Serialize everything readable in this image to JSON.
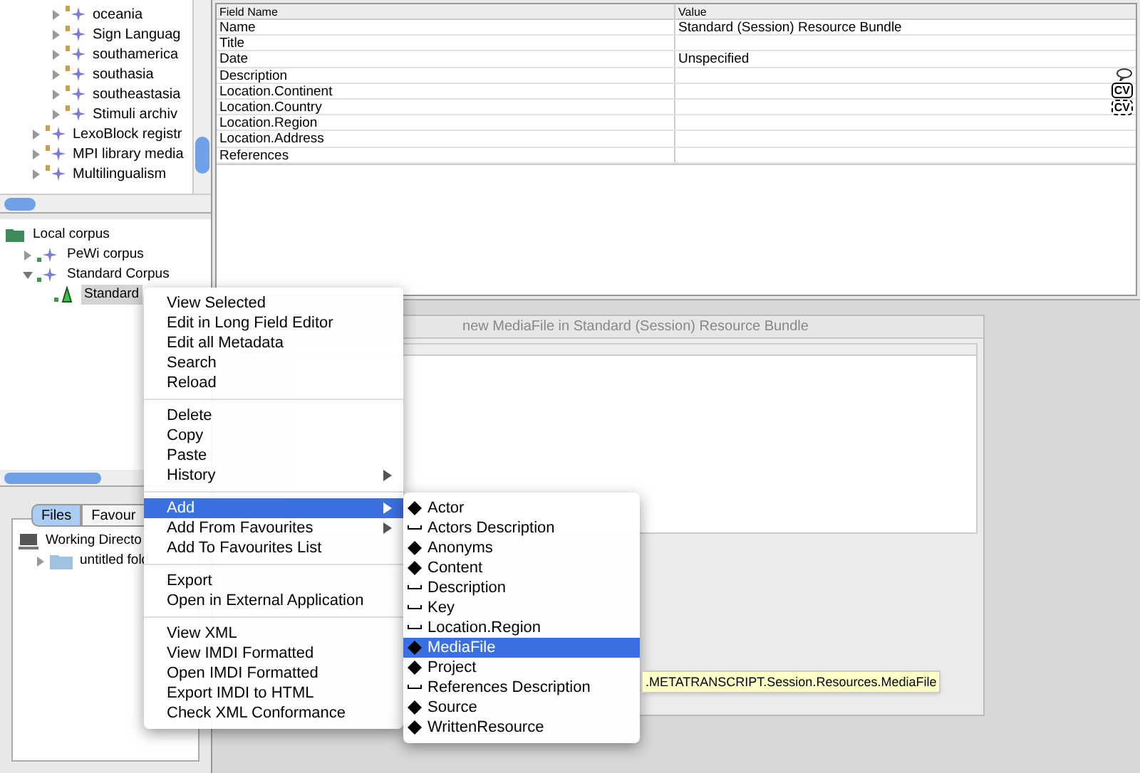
{
  "top_tree": {
    "items": [
      {
        "children": [
          {
            "label": "oceania",
            "expanded": false
          },
          {
            "label": "Sign Languag",
            "expanded": false
          },
          {
            "label": "southamerica",
            "expanded": false
          },
          {
            "label": "southasia",
            "expanded": false
          },
          {
            "label": "southeastasia",
            "expanded": false
          },
          {
            "label": "Stimuli archiv",
            "expanded": false
          }
        ]
      },
      {
        "label": "LexoBlock registr",
        "expanded": false
      },
      {
        "label": "MPI library media",
        "expanded": false
      },
      {
        "label": "Multilingualism",
        "expanded": false
      }
    ]
  },
  "local_tree": {
    "items": [
      {
        "label": "Local corpus",
        "kind": "root",
        "selected": false,
        "children": [
          {
            "label": "PeWi corpus",
            "kind": "corpus",
            "expanded": false,
            "selected": false
          },
          {
            "label": "Standard Corpus",
            "kind": "corpus",
            "expanded": true,
            "selected": false,
            "children": [
              {
                "label": "Standard",
                "kind": "session",
                "selected": true
              }
            ]
          }
        ]
      }
    ]
  },
  "file_tabs": [
    {
      "label": "Files",
      "selected": true
    },
    {
      "label": "Favour",
      "selected": false
    }
  ],
  "file_tree": {
    "items": [
      {
        "label": "Working Directo",
        "kind": "computer",
        "children": [
          {
            "label": "untitled fold",
            "kind": "folder",
            "expanded": false
          }
        ]
      }
    ]
  },
  "metadata_table": {
    "columns": [
      "Field Name",
      "Value"
    ],
    "rows": [
      {
        "field": "Name",
        "value": "Standard (Session) Resource Bundle",
        "kind": "text"
      },
      {
        "field": "Title",
        "kind": "text"
      },
      {
        "field": "Date",
        "value": "Unspecified",
        "kind": "text"
      },
      {
        "field": "Description",
        "kind": "comment"
      },
      {
        "field": "Location.Continent",
        "kind": "closed_vocabulary",
        "badge": "CV"
      },
      {
        "field": "Location.Country",
        "kind": "open_vocabulary",
        "badge": "CV"
      },
      {
        "field": "Location.Region",
        "kind": "text"
      },
      {
        "field": "Location.Address",
        "kind": "text"
      },
      {
        "field": "References",
        "kind": "text"
      }
    ]
  },
  "inner_window": {
    "title": "new MediaFile in Standard (Session) Resource Bundle"
  },
  "context_menu": {
    "sections": [
      [
        {
          "label": "View Selected",
          "submenu": false,
          "selected": false
        },
        {
          "label": "Edit in Long Field Editor",
          "submenu": false,
          "selected": false
        },
        {
          "label": "Edit all Metadata",
          "submenu": false,
          "selected": false
        },
        {
          "label": "Search",
          "submenu": false,
          "selected": false
        },
        {
          "label": "Reload",
          "submenu": false,
          "selected": false
        }
      ],
      [
        {
          "label": "Delete",
          "submenu": false,
          "selected": false
        },
        {
          "label": "Copy",
          "submenu": false,
          "selected": false
        },
        {
          "label": "Paste",
          "submenu": false,
          "selected": false
        },
        {
          "label": "History",
          "submenu": true,
          "selected": false
        }
      ],
      [
        {
          "label": "Add",
          "submenu": true,
          "selected": true
        },
        {
          "label": "Add From Favourites",
          "submenu": true,
          "selected": false
        },
        {
          "label": "Add To Favourites List",
          "submenu": false,
          "selected": false
        }
      ],
      [
        {
          "label": "Export",
          "submenu": false,
          "selected": false
        },
        {
          "label": "Open in External Application",
          "submenu": false,
          "selected": false
        }
      ],
      [
        {
          "label": "View XML",
          "submenu": false,
          "selected": false
        },
        {
          "label": "View IMDI Formatted",
          "submenu": false,
          "selected": false
        },
        {
          "label": "Open IMDI Formatted",
          "submenu": false,
          "selected": false
        },
        {
          "label": "Export IMDI to HTML",
          "submenu": false,
          "selected": false
        },
        {
          "label": "Check XML Conformance",
          "submenu": false,
          "selected": false
        }
      ]
    ]
  },
  "add_submenu": {
    "items": [
      {
        "label": "Actor",
        "kind": "element",
        "selected": false
      },
      {
        "label": "Actors Description",
        "kind": "field",
        "selected": false
      },
      {
        "label": "Anonyms",
        "kind": "element",
        "selected": false
      },
      {
        "label": "Content",
        "kind": "element",
        "selected": false
      },
      {
        "label": "Description",
        "kind": "field",
        "selected": false
      },
      {
        "label": "Key",
        "kind": "field",
        "selected": false
      },
      {
        "label": "Location.Region",
        "kind": "field",
        "selected": false
      },
      {
        "label": "MediaFile",
        "kind": "element",
        "selected": true
      },
      {
        "label": "Project",
        "kind": "element",
        "selected": false
      },
      {
        "label": "References Description",
        "kind": "field",
        "selected": false
      },
      {
        "label": "Source",
        "kind": "element",
        "selected": false
      },
      {
        "label": "WrittenResource",
        "kind": "element",
        "selected": false
      }
    ]
  },
  "tooltip": {
    "text": ".METATRANSCRIPT.Session.Resources.MediaFile"
  }
}
